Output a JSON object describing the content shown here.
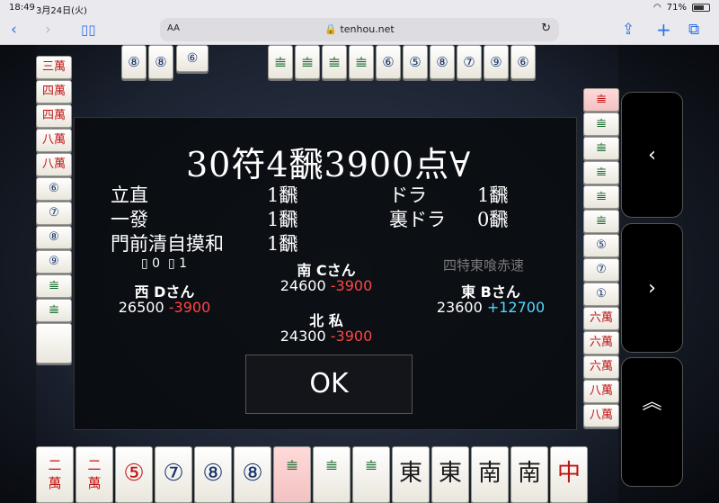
{
  "status": {
    "time": "18:49",
    "date": "3月24日(火)",
    "battery": "71%",
    "battery_level": 0.71
  },
  "browser": {
    "font_size_label": "AA",
    "url": "tenhou.net"
  },
  "result": {
    "headline": "30符4飜3900点∀",
    "yaku": [
      {
        "name": "立直",
        "han": "1飜"
      },
      {
        "name": "一發",
        "han": "1飜"
      },
      {
        "name": "門前清自摸和",
        "han": "1飜"
      },
      {
        "name": "ドラ",
        "han": "1飜"
      },
      {
        "name": "裏ドラ",
        "han": "0飜"
      }
    ],
    "sticks": {
      "hundred": "0",
      "thousand": "1"
    },
    "rule": "四特東喰赤速"
  },
  "players": {
    "south": {
      "name": "南 Cさん",
      "score": "24600",
      "delta": "-3900"
    },
    "west": {
      "name": "西 Dさん",
      "score": "26500",
      "delta": "-3900"
    },
    "east": {
      "name": "東 Bさん",
      "score": "23600",
      "delta": "+12700"
    },
    "north": {
      "name": "北 私",
      "score": "24300",
      "delta": "-3900"
    }
  },
  "ok_label": "OK",
  "hand_tiles": [
    {
      "glyph": "二萬",
      "color": "red",
      "hl": false
    },
    {
      "glyph": "二萬",
      "color": "red",
      "hl": false
    },
    {
      "glyph": "⑤",
      "color": "red",
      "hl": false
    },
    {
      "glyph": "⑦",
      "color": "blu",
      "hl": false
    },
    {
      "glyph": "⑧",
      "color": "blu",
      "hl": false
    },
    {
      "glyph": "⑧",
      "color": "blu",
      "hl": false
    },
    {
      "glyph": "𝍨",
      "color": "grn",
      "hl": true
    },
    {
      "glyph": "𝍨",
      "color": "grn",
      "hl": false
    },
    {
      "glyph": "𝍨",
      "color": "grn",
      "hl": false
    },
    {
      "glyph": "東",
      "color": "",
      "hl": false
    },
    {
      "glyph": "東",
      "color": "",
      "hl": false
    },
    {
      "glyph": "南",
      "color": "",
      "hl": false
    },
    {
      "glyph": "南",
      "color": "",
      "hl": false
    },
    {
      "glyph": "中",
      "color": "red",
      "hl": false
    }
  ]
}
